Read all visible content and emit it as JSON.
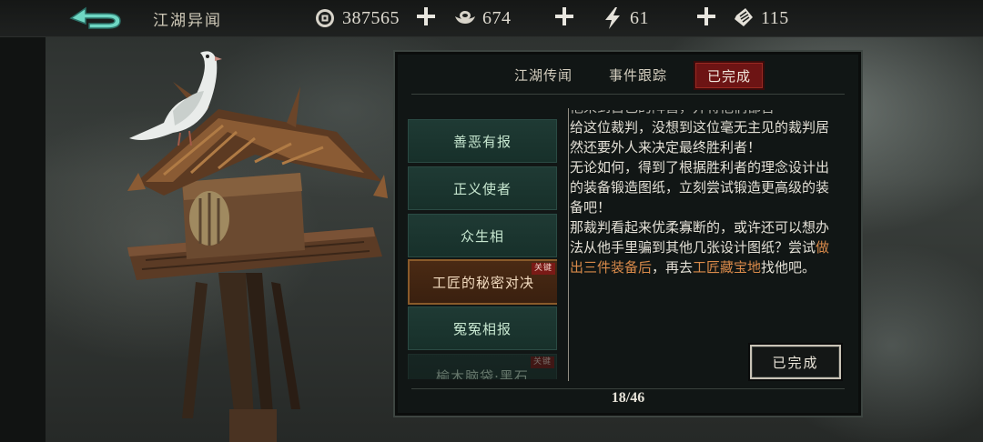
{
  "header": {
    "title": "江湖异闻",
    "resources": [
      {
        "icon": "coin-icon",
        "value": "387565"
      },
      {
        "icon": "silver-ingot-icon",
        "value": "674"
      },
      {
        "icon": "lightning-icon",
        "value": "61"
      },
      {
        "icon": "ticket-icon",
        "value": "115"
      }
    ]
  },
  "tabs": [
    {
      "label": "江湖传闻",
      "active": false
    },
    {
      "label": "事件跟踪",
      "active": false
    },
    {
      "label": "已完成",
      "active": true
    }
  ],
  "quests": [
    {
      "label": "善恶有报",
      "key": false
    },
    {
      "label": "正义使者",
      "key": false
    },
    {
      "label": "众生相",
      "key": false
    },
    {
      "label": "工匠的秘密对决",
      "key": true,
      "active": true
    },
    {
      "label": "冤冤相报",
      "key": false
    },
    {
      "label": "榆木脑袋·黑石",
      "key": true
    }
  ],
  "key_badge": "关键",
  "story": {
    "cut_top": "他来到自己的阵营，并将他们都告",
    "p1": "给这位裁判，没想到这位毫无主见的裁判居然还要外人来决定最终胜利者！",
    "p2": "无论如何，得到了根据胜利者的理念设计出的装备锻造图纸，立刻尝试锻造更高级的装备吧！",
    "p3_a": "那裁判看起来优柔寡断的，或许还可以想办法从他手里骗到其他几张设计图纸？尝试",
    "p3_hl1": "做出三件装备后",
    "p3_b": "，再去",
    "p3_hl2": "工匠藏宝地",
    "p3_c": "找他吧。"
  },
  "complete_button": "已完成",
  "pager": "18/46",
  "colors": {
    "accent_red": "#6d1414",
    "quest_green": "#1f3a34",
    "highlight_orange": "#d98a4a"
  }
}
